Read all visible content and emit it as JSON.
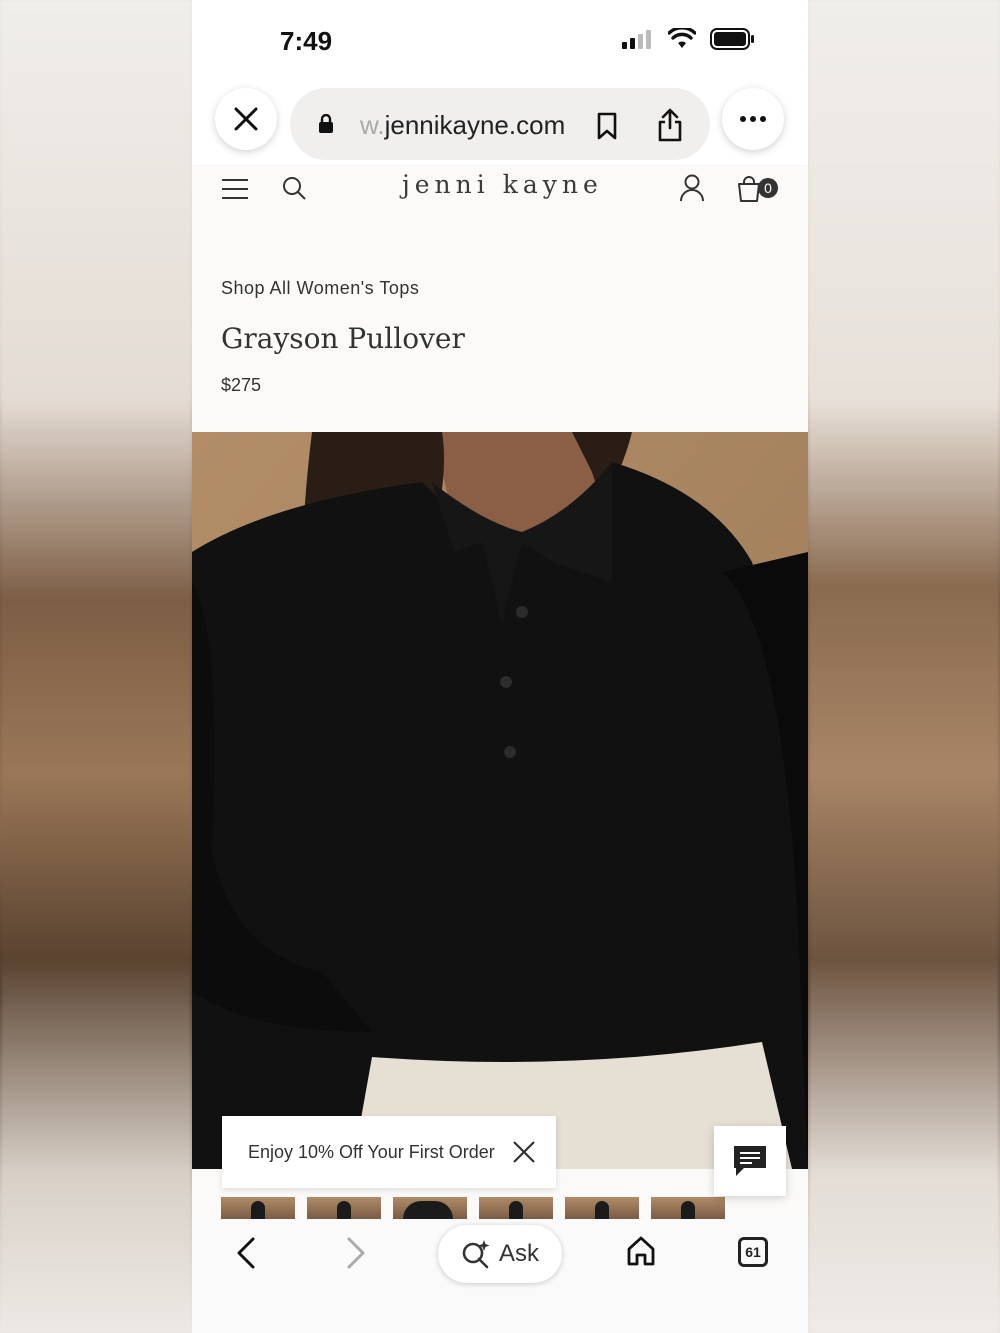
{
  "status_bar": {
    "time": "7:49"
  },
  "browser": {
    "url_prefix": "w.",
    "url_domain": "jennikayne.com"
  },
  "site": {
    "logo": "jenni kayne",
    "cart_count": "0"
  },
  "product": {
    "breadcrumb": "Shop All Women's Tops",
    "name": "Grayson Pullover",
    "price": "$275"
  },
  "promo": {
    "text": "Enjoy 10% Off Your First Order"
  },
  "toolbar": {
    "ask_label": "Ask",
    "tab_count": "61"
  },
  "icons": {
    "close": "close-icon",
    "lock": "lock-icon",
    "bookmark": "bookmark-icon",
    "share": "share-icon",
    "more": "more-icon",
    "menu": "menu-icon",
    "search": "search-icon",
    "account": "account-icon",
    "cart": "cart-icon",
    "chat": "chat-icon",
    "back": "back-icon",
    "forward": "forward-icon",
    "home": "home-icon",
    "tabs": "tabs-icon"
  }
}
